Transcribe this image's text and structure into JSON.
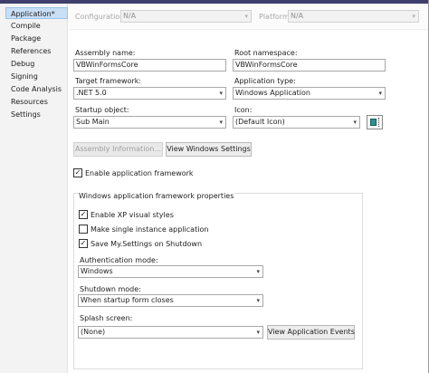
{
  "nav": {
    "items": [
      {
        "label": "Application*",
        "selected": true
      },
      {
        "label": "Compile"
      },
      {
        "label": "Package"
      },
      {
        "label": "References"
      },
      {
        "label": "Debug"
      },
      {
        "label": "Signing"
      },
      {
        "label": "Code Analysis"
      },
      {
        "label": "Resources"
      },
      {
        "label": "Settings"
      }
    ]
  },
  "header": {
    "configuration_label": "Configuration:",
    "configuration_value": "N/A",
    "platform_label": "Platform:",
    "platform_value": "N/A"
  },
  "form": {
    "assembly_name_label": "Assembly name:",
    "assembly_name_value": "VBWinFormsCore",
    "root_namespace_label": "Root namespace:",
    "root_namespace_value": "VBWinFormsCore",
    "target_framework_label": "Target framework:",
    "target_framework_value": ".NET 5.0",
    "application_type_label": "Application type:",
    "application_type_value": "Windows Application",
    "startup_object_label": "Startup object:",
    "startup_object_value": "Sub Main",
    "icon_label": "Icon:",
    "icon_value": "(Default Icon)",
    "assembly_info_button": "Assembly Information...",
    "view_windows_settings_button": "View Windows Settings",
    "enable_app_framework_label": "Enable application framework",
    "enable_app_framework_checked": true
  },
  "framework_group": {
    "title": "Windows application framework properties",
    "xp_styles_label": "Enable XP visual styles",
    "xp_styles_checked": true,
    "single_instance_label": "Make single instance application",
    "single_instance_checked": false,
    "save_settings_label": "Save My.Settings on Shutdown",
    "save_settings_checked": true,
    "auth_mode_label": "Authentication mode:",
    "auth_mode_value": "Windows",
    "shutdown_mode_label": "Shutdown mode:",
    "shutdown_mode_value": "When startup form closes",
    "splash_label": "Splash screen:",
    "splash_value": "(None)",
    "view_app_events_button": "View Application Events"
  },
  "glyphs": {
    "dropdown": "▾",
    "check": "✓"
  },
  "colors": {
    "nav_bg": "#f3f3f3",
    "nav_selected": "#c9dff5",
    "top_bar": "#3f3f6e",
    "icon_tile": "#2f8f8f"
  }
}
